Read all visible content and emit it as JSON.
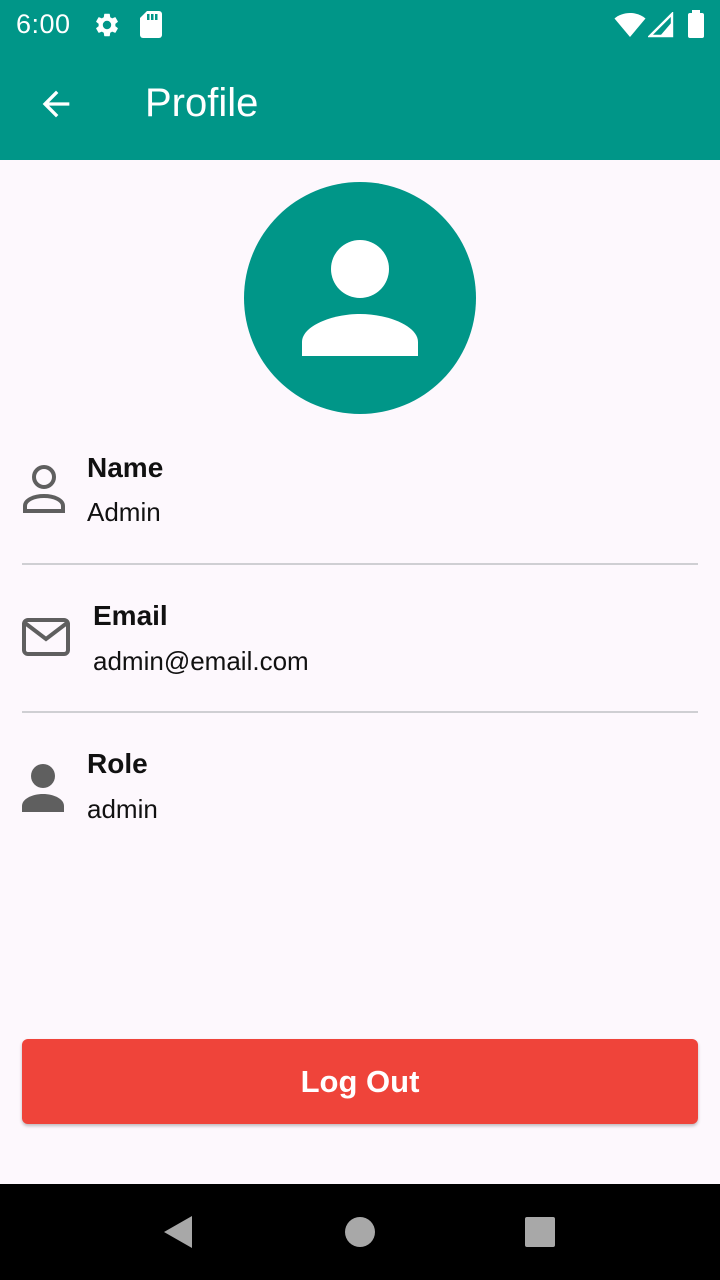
{
  "status_bar": {
    "time": "6:00",
    "icons": [
      "gear-icon",
      "sd-card-icon",
      "wifi-icon",
      "cell-signal-icon",
      "battery-icon"
    ]
  },
  "app_bar": {
    "title": "Profile",
    "back_icon": "arrow-left-icon",
    "color": "#009688"
  },
  "avatar": {
    "icon": "person-icon",
    "color": "#009688"
  },
  "profile_fields": [
    {
      "icon": "person-outline-icon",
      "title": "Name",
      "value": "Admin"
    },
    {
      "icon": "mail-outline-icon",
      "title": "Email",
      "value": "admin@email.com"
    },
    {
      "icon": "person-filled-icon",
      "title": "Role",
      "value": "admin"
    }
  ],
  "logout_button": {
    "label": "Log Out",
    "color": "#ef443a"
  },
  "nav_bar": {
    "buttons": [
      "back-triangle-icon",
      "home-circle-icon",
      "recents-square-icon"
    ]
  },
  "colors": {
    "background": "#fdf8fd",
    "icon_gray": "#5f5f5f",
    "divider": "#cfcfd3"
  }
}
